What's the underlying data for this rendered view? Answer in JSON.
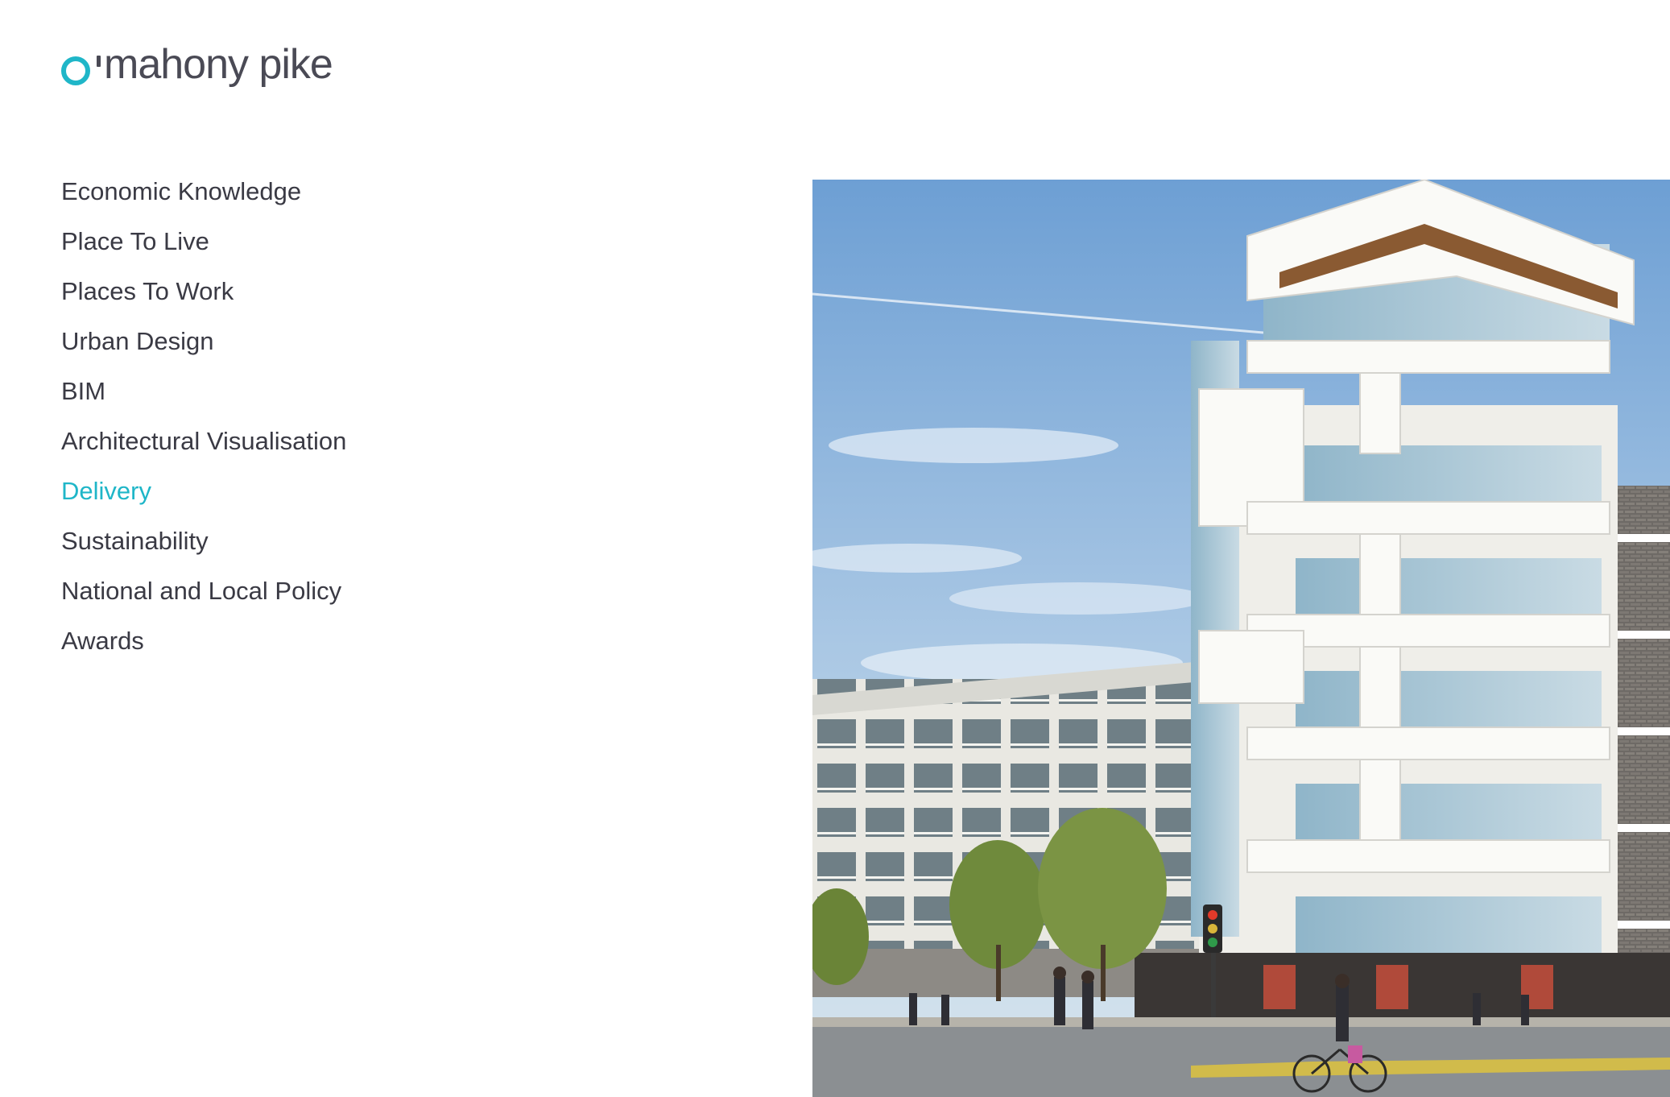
{
  "brand": {
    "logo_text": "mahony pike",
    "accent_color": "#1fb6c8",
    "text_color": "#4a4a55"
  },
  "menu": {
    "items": [
      {
        "label": "Economic Knowledge",
        "active": false
      },
      {
        "label": "Place To Live",
        "active": false
      },
      {
        "label": "Places To Work",
        "active": false
      },
      {
        "label": "Urban Design",
        "active": false
      },
      {
        "label": "BIM",
        "active": false
      },
      {
        "label": "Architectural Visualisation",
        "active": false
      },
      {
        "label": "Delivery",
        "active": true
      },
      {
        "label": "Sustainability",
        "active": false
      },
      {
        "label": "National and Local Policy",
        "active": false
      },
      {
        "label": "Awards",
        "active": false
      }
    ]
  },
  "hero": {
    "image_icon": "building-render-image"
  }
}
